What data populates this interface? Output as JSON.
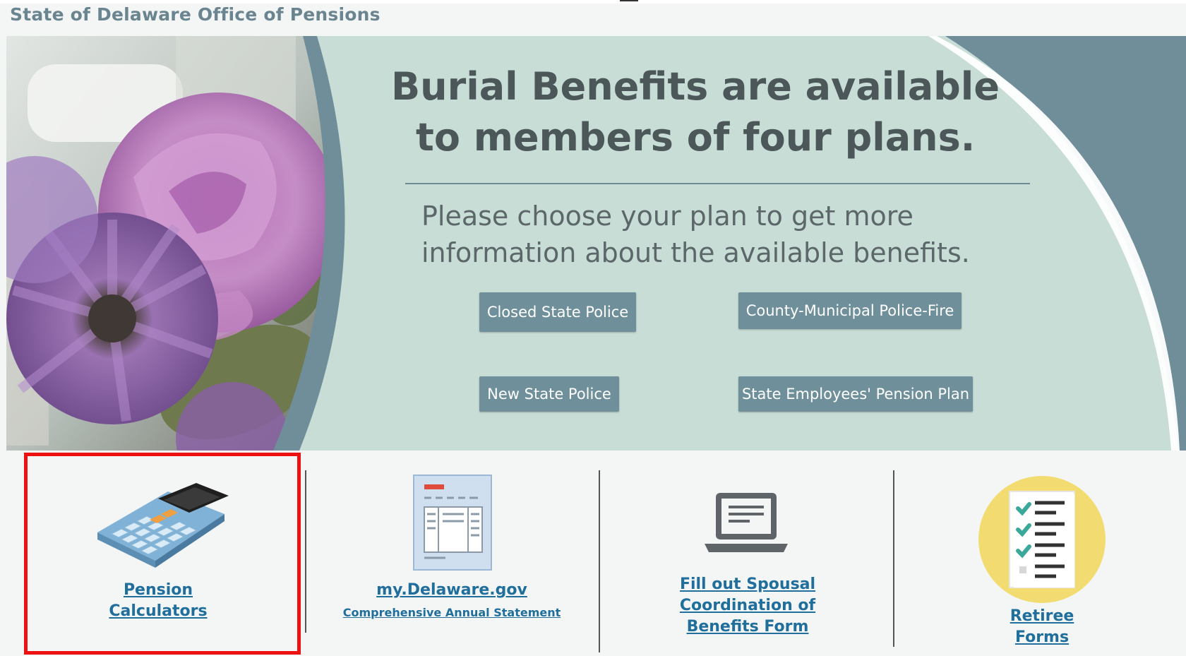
{
  "site": {
    "title": "State of Delaware Office of Pensions"
  },
  "banner": {
    "headline_line1": "Burial Benefits are available",
    "headline_line2": "to members of four plans.",
    "subtext_line1": "Please choose your plan to get more",
    "subtext_line2": "information about the available benefits.",
    "buttons": [
      {
        "label": "Closed State Police"
      },
      {
        "label": "County-Municipal Police-Fire"
      },
      {
        "label": "New State Police"
      },
      {
        "label": "State Employees' Pension Plan"
      }
    ],
    "colors": {
      "background": "#c9ddd7",
      "arc": "#6f8e9a",
      "button": "#6f909b",
      "text": "#4b5758"
    }
  },
  "tiles": [
    {
      "icon": "calculator-icon",
      "label_line1": "Pension",
      "label_line2": "Calculators"
    },
    {
      "icon": "document-statement-icon",
      "label": "my.Delaware.gov",
      "sublabel": "Comprehensive Annual Statement"
    },
    {
      "icon": "laptop-icon",
      "label_line1": "Fill out Spousal",
      "label_line2": "Coordination of",
      "label_line3": "Benefits Form"
    },
    {
      "icon": "checklist-icon",
      "label_line1": "Retiree",
      "label_line2": "Forms"
    }
  ],
  "colors": {
    "link": "#1f6e9c",
    "highlight": "#ee1111"
  }
}
